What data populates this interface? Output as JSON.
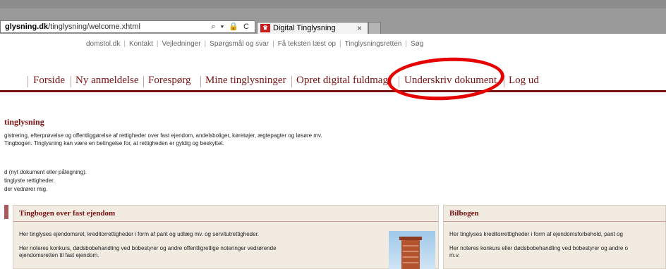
{
  "browser": {
    "address": "glysning.dk/tinglysning/welcome.xhtml",
    "address_domain": "glysning.dk",
    "address_path": "/tinglysning/welcome.xhtml",
    "address_controls": "⌕ ▾ 🔒 C",
    "tab_title": "Digital Tinglysning",
    "tab_close": "×"
  },
  "utility_links": [
    "domstol.dk",
    "Kontakt",
    "Vejledninger",
    "Spørgsmål og svar",
    "Få teksten læst op",
    "Tinglysningsretten",
    "Søg"
  ],
  "nav": {
    "items": [
      "Forside",
      "Ny anmeldelse",
      "Forespørg",
      "Mine tinglysninger",
      "Opret digital fuldmagt",
      "Underskriv dokument",
      "Log ud"
    ]
  },
  "intro": {
    "title": "tinglysning",
    "line1": "gistrering, efterprøvelse og offentliggørelse af rettigheder over fast ejendom, andelsboliger, køretøjer, ægtepagter og løsøre mv.",
    "line2": "Tingbogen. Tinglysning kan være en betingelse for, at rettigheden er gyldig og beskyttet.",
    "line3": "d (nyt dokument eller påtegning).",
    "line4": "tinglyste rettigheder.",
    "line5": "der vedrører mig."
  },
  "boxes": {
    "tingbogen": {
      "title": "Tingbogen over fast ejendom",
      "text1": "Her tinglyses ejendomsret, kreditorrettigheder i form af pant og udlæg mv. og servitutrettigheder.",
      "text2a": "Her noteres konkurs, dødsbobehandling ved bobestyrer og andre offentligretlige noteringer vedrørende",
      "text2b": "ejendomsretten til fast ejendom."
    },
    "bilbogen": {
      "title": "Bilbogen",
      "text1": "Her tinglyses kreditorrettigheder i form af ejendomsforbehold, pant og",
      "text2a": "Her noteres konkurs eller dødsbobehandling ved bobestyrer og andre o",
      "text2b": "m.v."
    }
  },
  "colors": {
    "brand": "#7a1010",
    "highlight_oval": "#e60000",
    "box_bg": "#f1ebe1"
  }
}
